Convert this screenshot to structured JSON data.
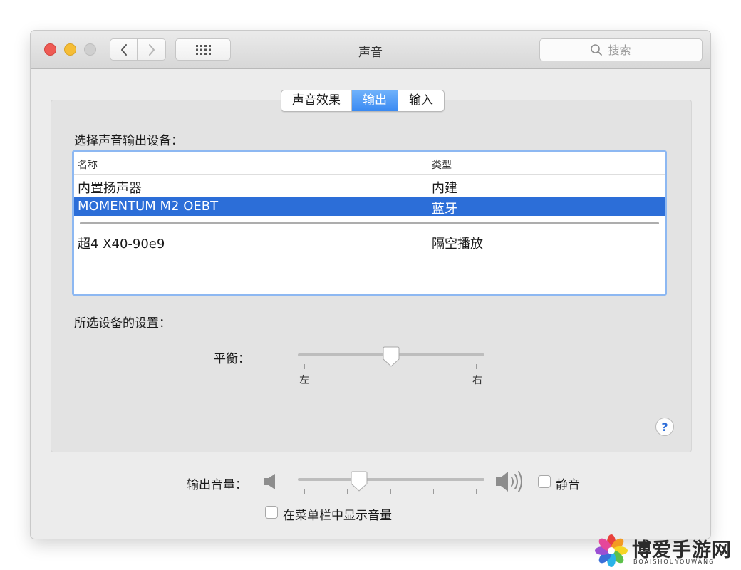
{
  "window": {
    "title": "声音",
    "search_placeholder": "搜索"
  },
  "tabs": [
    {
      "label": "声音效果",
      "active": false
    },
    {
      "label": "输出",
      "active": true
    },
    {
      "label": "输入",
      "active": false
    }
  ],
  "output": {
    "device_section_label": "选择声音输出设备：",
    "columns": {
      "name": "名称",
      "type": "类型"
    },
    "devices": [
      {
        "name": "内置扬声器",
        "type": "内建",
        "selected": false
      },
      {
        "name": "MOMENTUM M2 OEBT",
        "type": "蓝牙",
        "selected": true
      },
      {
        "name": "超4 X40-90e9",
        "type": "隔空播放",
        "selected": false
      }
    ],
    "settings_label": "所选设备的设置：",
    "balance": {
      "label": "平衡：",
      "left_label": "左",
      "right_label": "右",
      "value": 0.5
    }
  },
  "volume": {
    "label": "输出音量：",
    "value": 0.33,
    "mute_label": "静音",
    "mute_checked": false,
    "show_in_menubar_label": "在菜单栏中显示音量",
    "show_in_menubar_checked": false
  },
  "help_label": "?",
  "watermark": {
    "title": "博爱手游网",
    "subtitle": "BOAISHOUYOUWANG"
  },
  "colors": {
    "accent": "#2c6ed8",
    "tab_active": "#3a8af2",
    "close": "#ee5b55",
    "minimize": "#f5bd36",
    "zoom": "#cfcfcf"
  }
}
